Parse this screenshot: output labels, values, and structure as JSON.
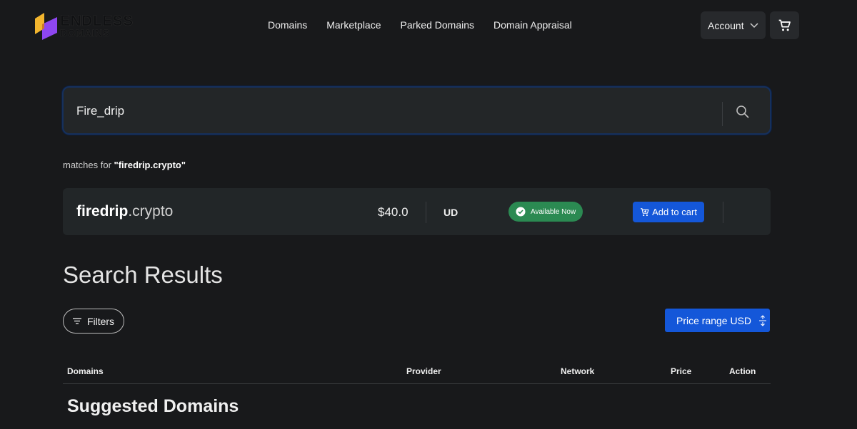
{
  "brand": {
    "word1": "ENDLESS",
    "word2": "DOMAINS",
    "colors": {
      "gold": "#f2b52e",
      "purple": "#8e46f0"
    }
  },
  "nav": {
    "items": [
      "Domains",
      "Marketplace",
      "Parked Domains",
      "Domain Appraisal"
    ]
  },
  "account": {
    "label": "Account"
  },
  "search": {
    "value": "Fire_drip",
    "placeholder": ""
  },
  "matches": {
    "prefix": "matches for",
    "query": "\"firedrip.crypto\""
  },
  "result": {
    "sld": "firedrip",
    "tld": ".crypto",
    "price": "$40.0",
    "provider": "UD",
    "status": "Available Now",
    "action": "Add to cart"
  },
  "results": {
    "title": "Search Results",
    "filters_label": "Filters",
    "price_range_label": "Price range USD"
  },
  "table": {
    "columns": [
      "Domains",
      "Provider",
      "Network",
      "Price",
      "Action"
    ]
  },
  "suggested": {
    "title": "Suggested Domains"
  },
  "colors": {
    "accent": "#1457d9",
    "success": "#2b8a52",
    "bg": "#18191b",
    "card": "#222628"
  }
}
